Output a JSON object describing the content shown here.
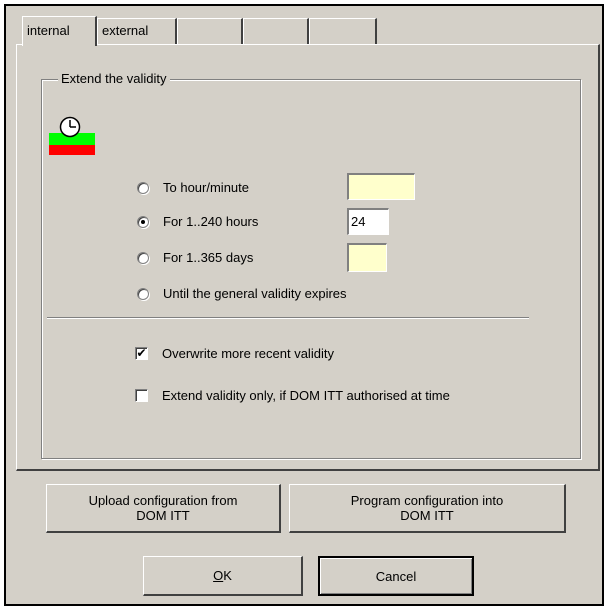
{
  "tabs": [
    {
      "label": "internal",
      "active": true
    },
    {
      "label": "external",
      "active": false
    },
    {
      "label": "",
      "active": false
    },
    {
      "label": "",
      "active": false
    },
    {
      "label": "",
      "active": false
    }
  ],
  "group": {
    "title": "Extend the validity",
    "icon": "clock-validity-icon",
    "options": [
      {
        "label": "To hour/minute",
        "selected": false,
        "field_value": ""
      },
      {
        "label": "For 1..240 hours",
        "selected": true,
        "field_value": "24"
      },
      {
        "label": "For 1..365 days",
        "selected": false,
        "field_value": ""
      },
      {
        "label": "Until the general validity expires",
        "selected": false
      }
    ],
    "checkboxes": [
      {
        "label": "Overwrite more recent validity",
        "checked": true
      },
      {
        "label": "Extend validity only, if DOM ITT authorised at time",
        "checked": false
      }
    ]
  },
  "buttons": {
    "upload": "Upload configuration from\nDOM ITT",
    "program": "Program configuration into\nDOM ITT",
    "ok_mnemonic": "O",
    "ok_rest": "K",
    "cancel": "Cancel"
  },
  "colors": {
    "dialog_bg": "#d4d0c8",
    "field_bg": "#ffffcc",
    "icon_green": "#00ff00",
    "icon_red": "#ff0000"
  }
}
